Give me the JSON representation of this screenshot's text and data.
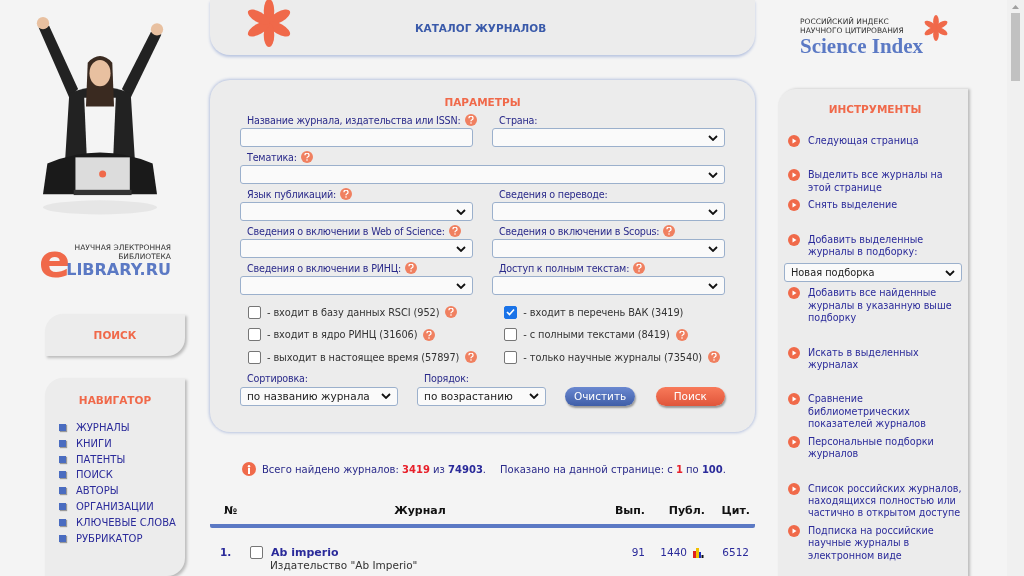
{
  "left": {
    "logo": {
      "letter": "e",
      "line1": "НАУЧНАЯ ЭЛЕКТРОННАЯ",
      "line2": "БИБЛИОТЕКА",
      "name": "LIBRARY.RU"
    },
    "search_card": {
      "label": "ПОИСК"
    },
    "navigator": {
      "title": "НАВИГАТОР",
      "items": [
        "ЖУРНАЛЫ",
        "КНИГИ",
        "ПАТЕНТЫ",
        "ПОИСК",
        "АВТОРЫ",
        "ОРГАНИЗАЦИИ",
        "КЛЮЧЕВЫЕ СЛОВА",
        "РУБРИКАТОР"
      ]
    }
  },
  "header": {
    "title": "КАТАЛОГ ЖУРНАЛОВ"
  },
  "params": {
    "title": "ПАРАМЕТРЫ",
    "rows": [
      [
        {
          "label": "Название журнала, издательства или ISSN:",
          "help": true,
          "kind": "text"
        },
        {
          "label": "Страна:",
          "help": false,
          "kind": "select"
        }
      ],
      [
        {
          "label": "Тематика:",
          "help": true,
          "kind": "select"
        }
      ],
      [
        {
          "label": "Язык публикаций:",
          "help": true,
          "kind": "select"
        },
        {
          "label": "Сведения о переводе:",
          "help": false,
          "kind": "select"
        }
      ],
      [
        {
          "label": "Сведения о включении в Web of Science:",
          "help": true,
          "kind": "select"
        },
        {
          "label": "Сведения о включении в Scopus:",
          "help": true,
          "kind": "select"
        }
      ],
      [
        {
          "label": "Сведения о включении в РИНЦ:",
          "help": true,
          "kind": "select"
        },
        {
          "label": "Доступ к полным текстам:",
          "help": true,
          "kind": "select"
        }
      ]
    ],
    "checkboxes": [
      {
        "label": "- входит в базу данных RSCI (952)",
        "checked": false,
        "help": true
      },
      {
        "label": "- входит в перечень ВАК (3419)",
        "checked": true,
        "help": false
      },
      {
        "label": "- входит в ядро РИНЦ (31606)",
        "checked": false,
        "help": true
      },
      {
        "label": "- с полными текстами (8419)",
        "checked": false,
        "help": true
      },
      {
        "label": "- выходит в настоящее время (57897)",
        "checked": false,
        "help": true
      },
      {
        "label": "- только научные журналы (73540)",
        "checked": false,
        "help": true
      }
    ],
    "sort": {
      "label": "Сортировка:",
      "value": "по названию журнала"
    },
    "order": {
      "label": "Порядок:",
      "value": "по возрастанию"
    },
    "buttons": [
      {
        "label": "Очистить",
        "kind": "secondary"
      },
      {
        "label": "Поиск",
        "kind": "primary"
      }
    ]
  },
  "summary": {
    "found": "Всего найдено журналов: **3419** из **74903**.",
    "shown": "Показано на данной странице: с **1** по **100**."
  },
  "table": {
    "columns": [
      "№",
      "Журнал",
      "Вып.",
      "Публ.",
      "Цит."
    ],
    "rows": [
      {
        "number": "1.",
        "checked": false,
        "title": "Ab imperio",
        "publisher": "Издательство \"Ab Imperio\"",
        "issues": "91",
        "publications": "1440",
        "citations": "6512"
      }
    ]
  },
  "right": {
    "logo": {
      "line1": "РОССИЙСКИЙ ИНДЕКС",
      "line2": "НАУЧНОГО ЦИТИРОВАНИЯ",
      "name": "Science Index"
    },
    "tools": {
      "title": "ИНСТРУМЕНТЫ",
      "groups": [
        [
          {
            "kind": "link",
            "label": "Следующая страница"
          }
        ],
        [
          {
            "kind": "link",
            "label": "Выделить все журналы на этой странице"
          },
          {
            "kind": "link",
            "label": "Снять выделение"
          }
        ],
        [
          {
            "kind": "link",
            "label": "Добавить выделенные журналы в подборку:"
          },
          {
            "kind": "select",
            "value": "Новая подборка"
          },
          {
            "kind": "link",
            "label": "Добавить все найденные журналы в указанную выше подборку"
          }
        ],
        [
          {
            "kind": "link",
            "label": "Искать в выделенных журналах"
          }
        ],
        [
          {
            "kind": "link",
            "label": "Сравнение библиометрических показателей журналов"
          },
          {
            "kind": "link",
            "label": "Персональные подборки журналов"
          }
        ],
        [
          {
            "kind": "link",
            "label": "Список российских журналов, находящихся полностью или частично в открытом доступе"
          },
          {
            "kind": "link",
            "label": "Подписка на российские научные журналы в электронном виде"
          }
        ]
      ]
    }
  }
}
